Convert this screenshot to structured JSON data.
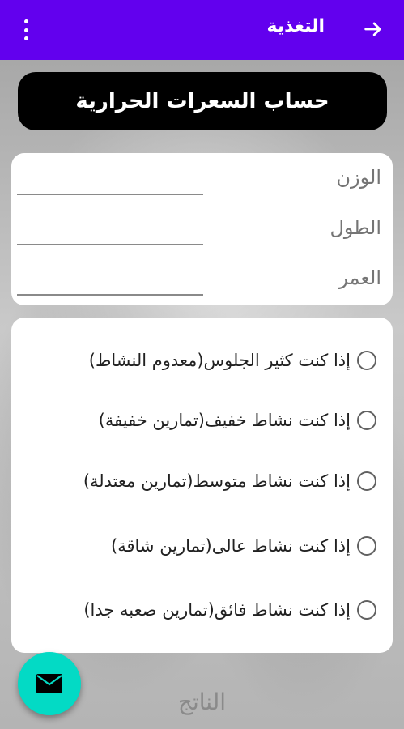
{
  "appbar": {
    "title": "التغذية",
    "back_icon": "arrow-forward-icon",
    "menu_icon": "more-vertical-icon",
    "color": "#6200ee"
  },
  "header": {
    "title": "حساب السعرات الحرارية"
  },
  "inputs": [
    {
      "label": "الوزن",
      "value": ""
    },
    {
      "label": "الطول",
      "value": ""
    },
    {
      "label": "العمر",
      "value": ""
    }
  ],
  "activity_options": [
    {
      "label": "إذا كنت كثير الجلوس(معدوم النشاط)",
      "selected": false
    },
    {
      "label": "إذا كنت نشاط خفيف(تمارين خفيفة)",
      "selected": false
    },
    {
      "label": "إذا كنت نشاط متوسط(تمارين معتدلة)",
      "selected": false
    },
    {
      "label": "إذا كنت نشاط عالى(تمارين شاقة)",
      "selected": false
    },
    {
      "label": "إذا كنت نشاط فائق(تمارين صعبه جدا)",
      "selected": false
    }
  ],
  "fab": {
    "icon": "mail-icon",
    "color": "#03dac5"
  },
  "result_label": "الناتج"
}
